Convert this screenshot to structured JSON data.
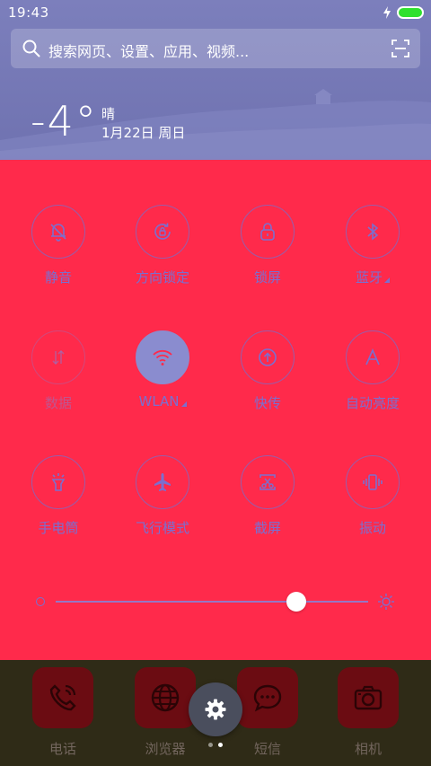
{
  "status_bar": {
    "time": "19:43"
  },
  "search": {
    "placeholder": "搜索网页、设置、应用、视频..."
  },
  "weather": {
    "temperature": "-4°",
    "condition": "晴",
    "date": "1月22日 周日"
  },
  "toggles": [
    {
      "label": "静音",
      "icon": "bell-off-icon",
      "active": false,
      "dim": false,
      "has_more": false
    },
    {
      "label": "方向锁定",
      "icon": "rotation-lock-icon",
      "active": false,
      "dim": false,
      "has_more": false
    },
    {
      "label": "锁屏",
      "icon": "lock-icon",
      "active": false,
      "dim": false,
      "has_more": false
    },
    {
      "label": "蓝牙",
      "icon": "bluetooth-icon",
      "active": false,
      "dim": false,
      "has_more": true
    },
    {
      "label": "数据",
      "icon": "data-arrows-icon",
      "active": false,
      "dim": true,
      "has_more": false
    },
    {
      "label": "WLAN",
      "icon": "wifi-icon",
      "active": true,
      "dim": false,
      "has_more": true
    },
    {
      "label": "快传",
      "icon": "transfer-icon",
      "active": false,
      "dim": false,
      "has_more": false
    },
    {
      "label": "自动亮度",
      "icon": "auto-brightness-icon",
      "active": false,
      "dim": false,
      "has_more": false
    },
    {
      "label": "手电筒",
      "icon": "flashlight-icon",
      "active": false,
      "dim": false,
      "has_more": false
    },
    {
      "label": "飞行模式",
      "icon": "airplane-icon",
      "active": false,
      "dim": false,
      "has_more": false
    },
    {
      "label": "截屏",
      "icon": "screenshot-icon",
      "active": false,
      "dim": false,
      "has_more": false
    },
    {
      "label": "振动",
      "icon": "vibrate-icon",
      "active": false,
      "dim": false,
      "has_more": false
    }
  ],
  "brightness": {
    "level": 0.77
  },
  "dock": [
    {
      "label": "电话",
      "icon": "phone-icon"
    },
    {
      "label": "浏览器",
      "icon": "globe-icon"
    },
    {
      "label": "短信",
      "icon": "message-icon"
    },
    {
      "label": "相机",
      "icon": "camera-icon"
    }
  ],
  "pages": {
    "count": 2,
    "current": 2
  },
  "colors": {
    "panel": "#ff2a4b",
    "accent": "#7b6fcf",
    "header": "#7c7fbc",
    "dock": "#2f2b17"
  }
}
